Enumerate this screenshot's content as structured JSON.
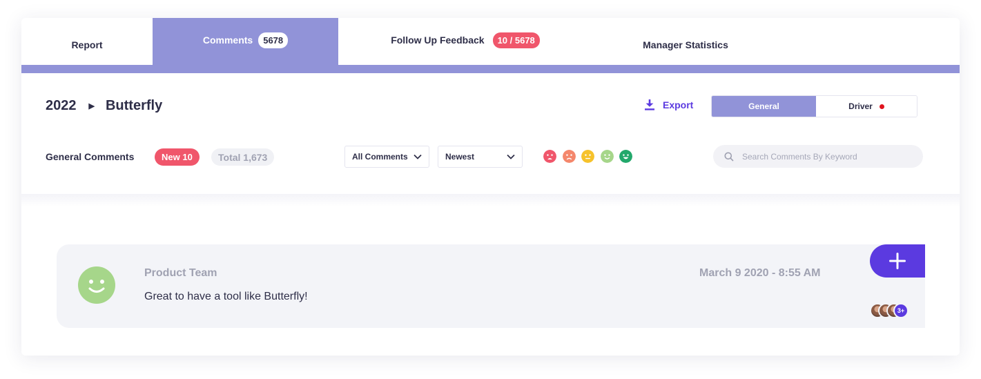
{
  "tabs": {
    "report": "Report",
    "comments": "Comments",
    "comments_count": "5678",
    "follow_up": "Follow Up Feedback",
    "follow_up_count": "10 / 5678",
    "manager": "Manager Statistics"
  },
  "breadcrumb": {
    "year": "2022",
    "name": "Butterfly"
  },
  "toolbar": {
    "export_label": "Export",
    "general_label": "General",
    "driver_label": "Driver"
  },
  "filters": {
    "section_label": "General Comments",
    "new_badge": "New 10",
    "total_badge": "Total 1,673",
    "all_comments": "All Comments",
    "sort": "Newest",
    "search_placeholder": "Search Comments By Keyword"
  },
  "sentiments": [
    {
      "icon": "very-sad-face-icon",
      "color": "#f0566b"
    },
    {
      "icon": "sad-face-icon",
      "color": "#f4876c"
    },
    {
      "icon": "neutral-face-icon",
      "color": "#f6c22b"
    },
    {
      "icon": "happy-face-icon",
      "color": "#a6d68a"
    },
    {
      "icon": "very-happy-face-icon",
      "color": "#22a86b"
    }
  ],
  "comment": {
    "author": "Product Team",
    "date": "March 9 2020 - 8:55 AM",
    "text": "Great to have a tool like Butterfly!",
    "more_count": "3+",
    "sentiment_color": "#a6d68a"
  },
  "colors": {
    "accent": "#9193d8",
    "primary": "#5b3ae0",
    "alert": "#f0566b"
  }
}
